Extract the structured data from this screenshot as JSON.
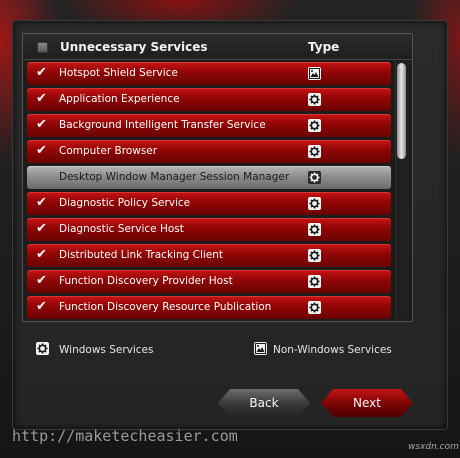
{
  "header": {
    "title": "Unnecessary Services",
    "type_label": "Type"
  },
  "services": [
    {
      "name": "Hotspot Shield Service",
      "checked": true,
      "type": "non-windows-service-icon"
    },
    {
      "name": "Application Experience",
      "checked": true,
      "type": "windows-service-icon"
    },
    {
      "name": "Background Intelligent Transfer Service",
      "checked": true,
      "type": "windows-service-icon"
    },
    {
      "name": "Computer Browser",
      "checked": true,
      "type": "windows-service-icon"
    },
    {
      "name": "Desktop Window Manager Session Manager",
      "checked": false,
      "selected": true,
      "type": "windows-service-icon"
    },
    {
      "name": "Diagnostic Policy Service",
      "checked": true,
      "type": "windows-service-icon"
    },
    {
      "name": "Diagnostic Service Host",
      "checked": true,
      "type": "windows-service-icon"
    },
    {
      "name": "Distributed Link Tracking Client",
      "checked": true,
      "type": "windows-service-icon"
    },
    {
      "name": "Function Discovery Provider Host",
      "checked": true,
      "type": "windows-service-icon"
    },
    {
      "name": "Function Discovery Resource Publication",
      "checked": true,
      "type": "windows-service-icon"
    }
  ],
  "check_mark": "✔",
  "legend": {
    "windows_label": "Windows Services",
    "non_windows_label": "Non-Windows Services"
  },
  "buttons": {
    "back": "Back",
    "next": "Next"
  },
  "watermark": {
    "url": "http://maketecheasier.com",
    "logo": "wsxdn.com"
  },
  "colors": {
    "accent_red": "#b00d0d",
    "selected_gray": "#9a9a9a",
    "background": "#1b1b1b"
  }
}
